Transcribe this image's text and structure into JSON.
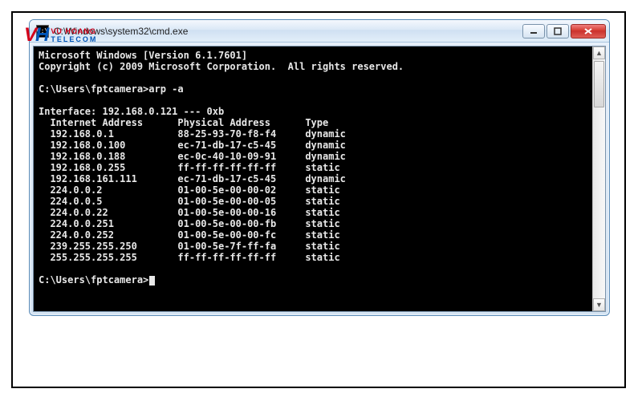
{
  "watermark": {
    "v": "V",
    "h": "H",
    "line1": "VU HOANG",
    "line2": "TELECOM"
  },
  "window": {
    "title": "C:\\Windows\\system32\\cmd.exe",
    "icon_label": "C:\\"
  },
  "console": {
    "banner1": "Microsoft Windows [Version 6.1.7601]",
    "banner2": "Copyright (c) 2009 Microsoft Corporation.  All rights reserved.",
    "prompt1": "C:\\Users\\fptcamera>arp -a",
    "interface_line": "Interface: 192.168.0.121 --- 0xb",
    "header": {
      "c1": "Internet Address",
      "c2": "Physical Address",
      "c3": "Type"
    },
    "rows": [
      {
        "ip": "192.168.0.1",
        "mac": "88-25-93-70-f8-f4",
        "type": "dynamic"
      },
      {
        "ip": "192.168.0.100",
        "mac": "ec-71-db-17-c5-45",
        "type": "dynamic"
      },
      {
        "ip": "192.168.0.188",
        "mac": "ec-0c-40-10-09-91",
        "type": "dynamic"
      },
      {
        "ip": "192.168.0.255",
        "mac": "ff-ff-ff-ff-ff-ff",
        "type": "static"
      },
      {
        "ip": "192.168.161.111",
        "mac": "ec-71-db-17-c5-45",
        "type": "dynamic"
      },
      {
        "ip": "224.0.0.2",
        "mac": "01-00-5e-00-00-02",
        "type": "static"
      },
      {
        "ip": "224.0.0.5",
        "mac": "01-00-5e-00-00-05",
        "type": "static"
      },
      {
        "ip": "224.0.0.22",
        "mac": "01-00-5e-00-00-16",
        "type": "static"
      },
      {
        "ip": "224.0.0.251",
        "mac": "01-00-5e-00-00-fb",
        "type": "static"
      },
      {
        "ip": "224.0.0.252",
        "mac": "01-00-5e-00-00-fc",
        "type": "static"
      },
      {
        "ip": "239.255.255.250",
        "mac": "01-00-5e-7f-ff-fa",
        "type": "static"
      },
      {
        "ip": "255.255.255.255",
        "mac": "ff-ff-ff-ff-ff-ff",
        "type": "static"
      }
    ],
    "prompt2": "C:\\Users\\fptcamera>"
  },
  "colors": {
    "close_red": "#d43a2f",
    "frame_blue": "#cfe0f2",
    "console_bg": "#000000",
    "console_fg": "#e8e8e8"
  }
}
